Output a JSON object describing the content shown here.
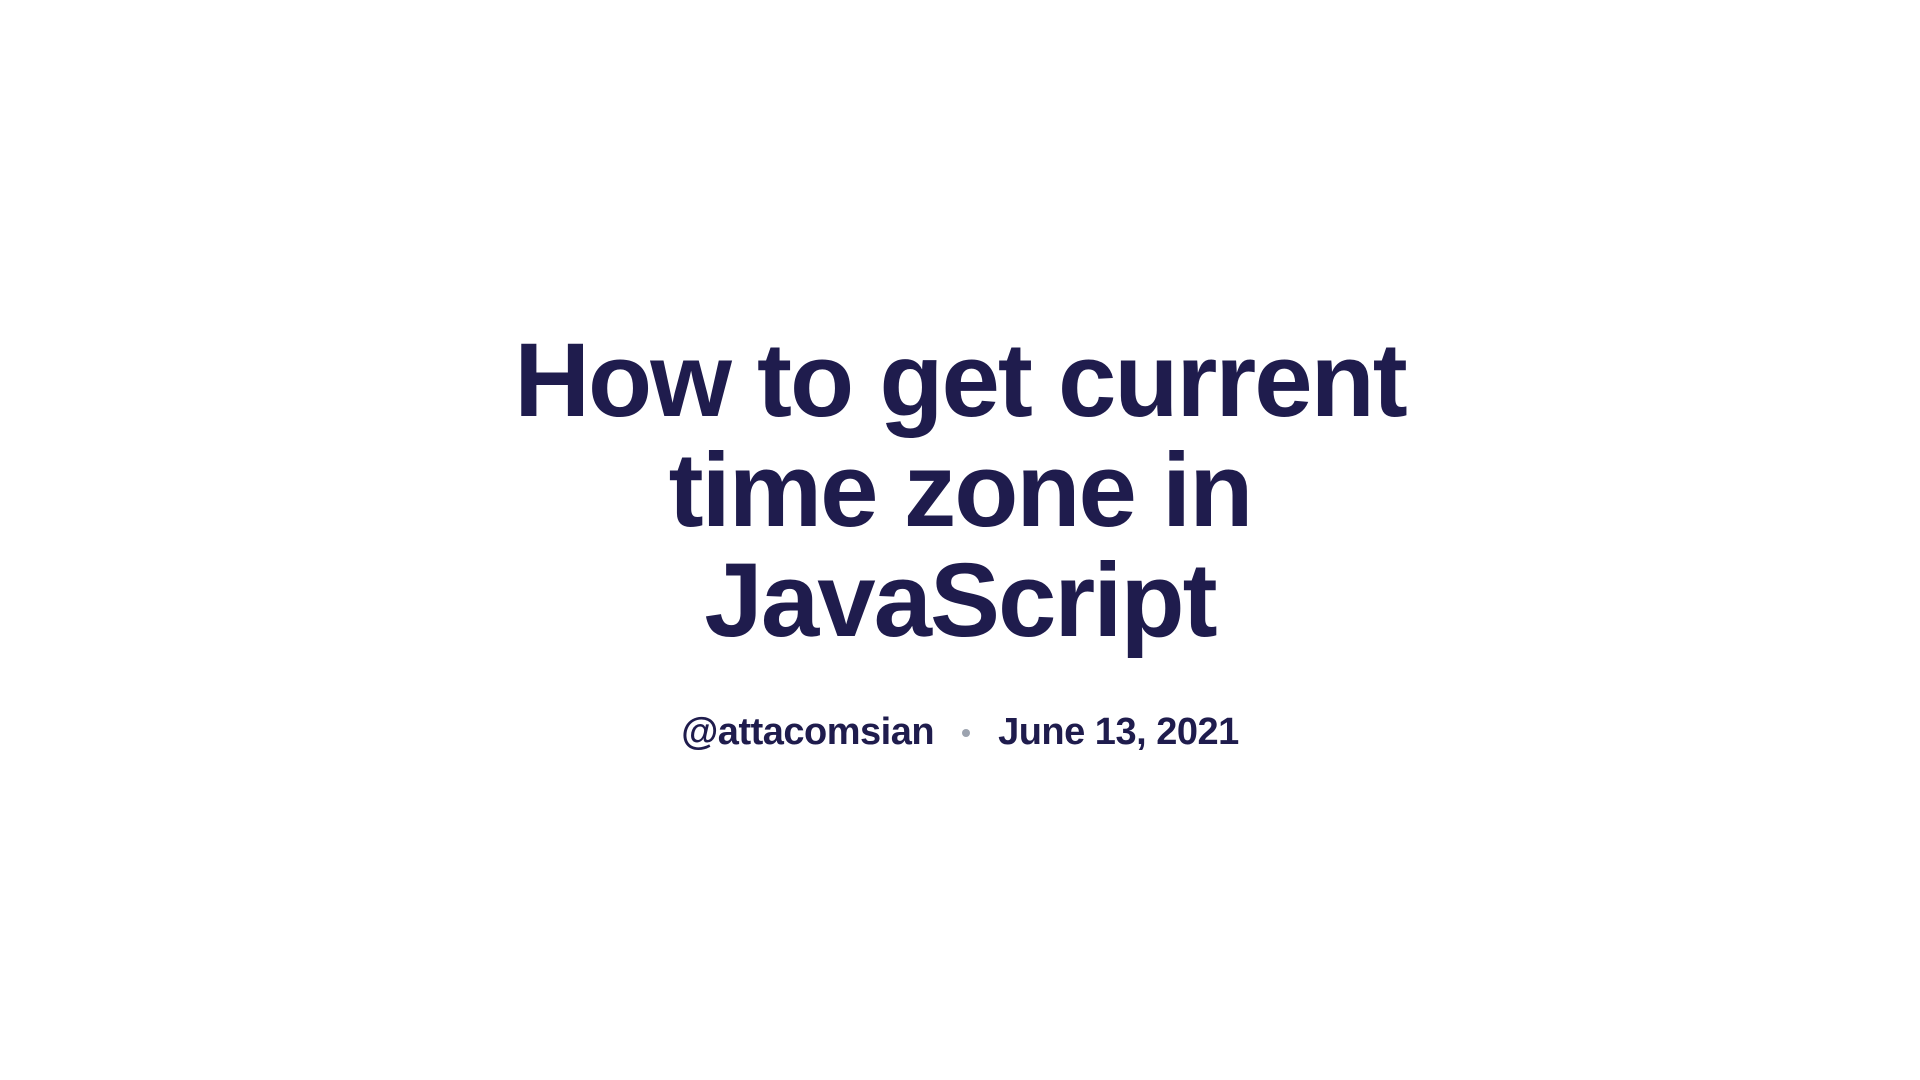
{
  "article": {
    "title": "How to get current time zone in JavaScript",
    "author": "@attacomsian",
    "date": "June 13, 2021"
  }
}
